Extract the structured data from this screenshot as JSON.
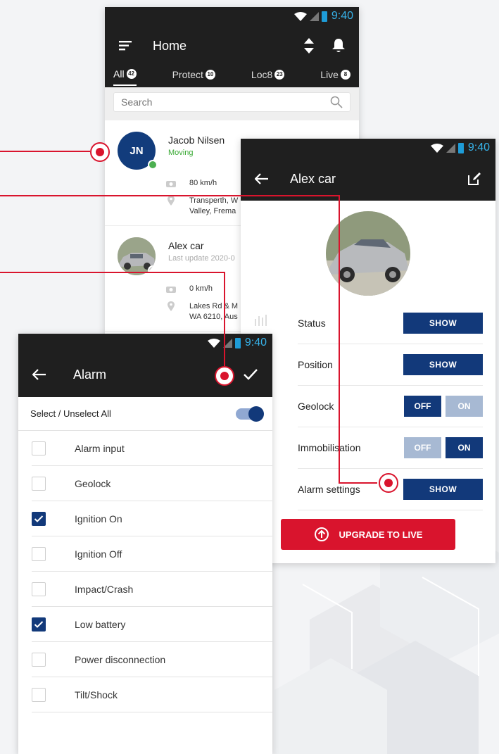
{
  "status_bar": {
    "time": "9:40"
  },
  "home": {
    "title": "Home",
    "tabs": [
      {
        "label": "All",
        "count": "42"
      },
      {
        "label": "Protect",
        "count": "10"
      },
      {
        "label": "Loc8",
        "count": "23"
      },
      {
        "label": "Live",
        "count": "8"
      }
    ],
    "search_placeholder": "Search",
    "vehicles": [
      {
        "initials": "JN",
        "name": "Jacob Nilsen",
        "status": "Moving",
        "speed": "80 km/h",
        "address_line1": "Transperth, W",
        "address_line2": "Valley, Frema"
      },
      {
        "name": "Alex car",
        "status": "Last update 2020-0",
        "speed": "0 km/h",
        "address_line1": "Lakes Rd & M",
        "address_line2": "WA 6210, Aus"
      }
    ]
  },
  "car_detail": {
    "title": "Alex car",
    "settings": {
      "status": {
        "label": "Status",
        "button": "SHOW"
      },
      "position": {
        "label": "Position",
        "button": "SHOW"
      },
      "geolock": {
        "label": "Geolock",
        "off": "OFF",
        "on": "ON",
        "selected": "OFF"
      },
      "immobilisation": {
        "label": "Immobilisation",
        "off": "OFF",
        "on": "ON",
        "selected": "ON"
      },
      "alarm_settings": {
        "label": "Alarm settings",
        "button": "SHOW"
      }
    },
    "upgrade_label": "UPGRADE TO LIVE"
  },
  "alarm": {
    "title": "Alarm",
    "select_all_label": "Select / Unselect All",
    "select_all_on": true,
    "items": [
      {
        "label": "Alarm input",
        "checked": false
      },
      {
        "label": "Geolock",
        "checked": false
      },
      {
        "label": "Ignition On",
        "checked": true
      },
      {
        "label": "Ignition Off",
        "checked": false
      },
      {
        "label": "Impact/Crash",
        "checked": false
      },
      {
        "label": "Low battery",
        "checked": true
      },
      {
        "label": "Power disconnection",
        "checked": false
      },
      {
        "label": "Tilt/Shock",
        "checked": false
      }
    ]
  },
  "colors": {
    "navy": "#12397a",
    "red": "#d9142d",
    "dark": "#1f1f1f",
    "green": "#3aa935"
  }
}
